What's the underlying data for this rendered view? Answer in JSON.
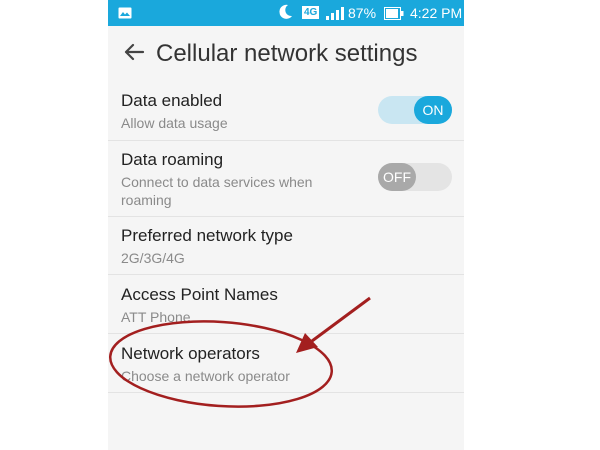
{
  "status_bar": {
    "network": "4G",
    "battery": "87%",
    "time": "4:22 PM",
    "background_color": "#1aa8dc",
    "icons": [
      "photo-icon",
      "moon-icon",
      "signal-icon",
      "battery-icon"
    ]
  },
  "app_bar": {
    "title": "Cellular network settings",
    "back_icon": "arrow-left-icon"
  },
  "settings": {
    "data_enabled": {
      "title": "Data enabled",
      "subtitle": "Allow data usage",
      "toggle": "ON"
    },
    "data_roaming": {
      "title": "Data roaming",
      "subtitle": "Connect to data services when roaming",
      "toggle": "OFF"
    },
    "preferred_network": {
      "title": "Preferred network type",
      "subtitle": "2G/3G/4G"
    },
    "apn": {
      "title": "Access Point Names",
      "subtitle": "ATT Phone"
    },
    "network_operators": {
      "title": "Network operators",
      "subtitle": "Choose a network operator"
    }
  },
  "annotation": {
    "color": "#a31f1f",
    "shapes": [
      "ellipse",
      "arrow"
    ]
  },
  "accent_color": "#1aa8dc"
}
